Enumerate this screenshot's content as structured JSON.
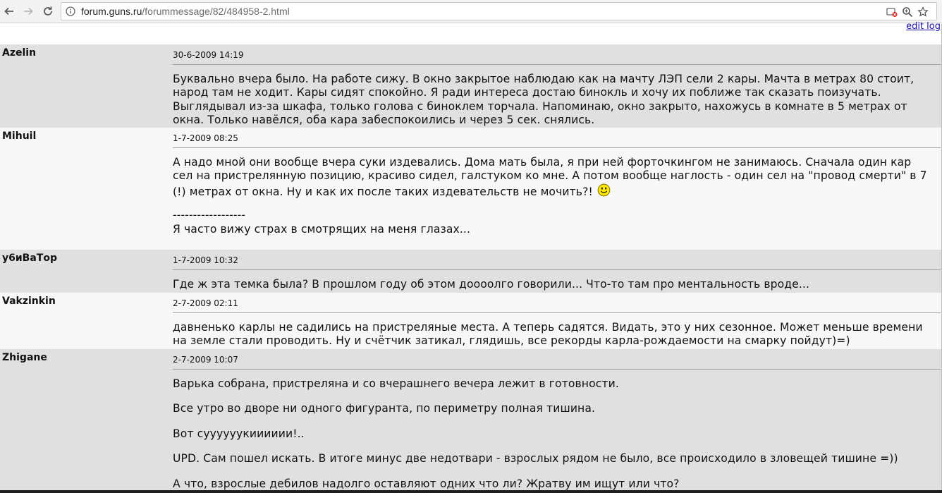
{
  "browser": {
    "url_host": "forum.guns.ru",
    "url_path": "/forummessage/82/484958-2.html"
  },
  "page": {
    "edit_log": "edit log"
  },
  "posts": [
    {
      "author": "Azelin",
      "date": "30-6-2009 14:19",
      "lines": [
        "Буквально вчера было. На работе сижу. В окно закрытое наблюдаю как на мачту ЛЭП сели 2 кары. Мачта в метрах 80 стоит,",
        "народ там не ходит. Кары сидят спокойно. Я ради интереса достаю бинокль и хочу их поближе так сказать поизучать.",
        "Выглядывал из-за шкафа, только голова с биноклем торчала. Напоминаю, окно закрыто, нахожусь в комнате в 5 метрах от",
        "окна. Только навёлся, оба кара забеспокоились и через 5 сек. снялись."
      ]
    },
    {
      "author": "Mihuil",
      "date": "1-7-2009 08:25",
      "lines": [
        "А надо мной они вообще вчера суки издевались. Дома мать была, я при ней форточкингом не занимаюсь. Сначала один кар",
        "сел на пристрелянную позицию, красиво сидел, галстуком ко мне. А потом вообще наглость - один сел на \"провод смерти\" в 7",
        "(!) метрах от окна. Ну и как их после таких издевательств не мочить?!"
      ],
      "signature_rule": "------------------",
      "signature": "Я часто вижу страх в смотрящих на меня глазах..."
    },
    {
      "author": "у6иВаТор",
      "date": "1-7-2009 10:32",
      "lines": [
        "Где ж эта темка была? В прошлом году об этом доооолго говорили... Что-то там про ментальность вроде..."
      ]
    },
    {
      "author": "Vakzinkin",
      "date": "2-7-2009 02:11",
      "lines": [
        "давненько карлы не садились на пристреляные места. А теперь садятся. Видать, это у них сезонное. Может меньше времени",
        "на земле стали проводить. Ну и счётчик затикал, глядишь, все рекорды карла-рождаемости на смарку пойдут)=)"
      ]
    },
    {
      "author": "Zhigane",
      "date": "2-7-2009 10:07",
      "paragraphs": [
        "Варька собрана, пристреляна и со вчерашнего вечера лежит в готовности.",
        "Все утро во дворе ни одного фигуранта, по периметру полная тишина.",
        "Вот суууууукииииии!..",
        "UPD. Сам пошел искать. В итоге минус две недотвари - взрослых рядом не было, все происходило в зловещей тишине =))",
        "А что, взрослые дебилов надолго оставляют одних что ли? Жратву им ищут или что?"
      ]
    }
  ]
}
